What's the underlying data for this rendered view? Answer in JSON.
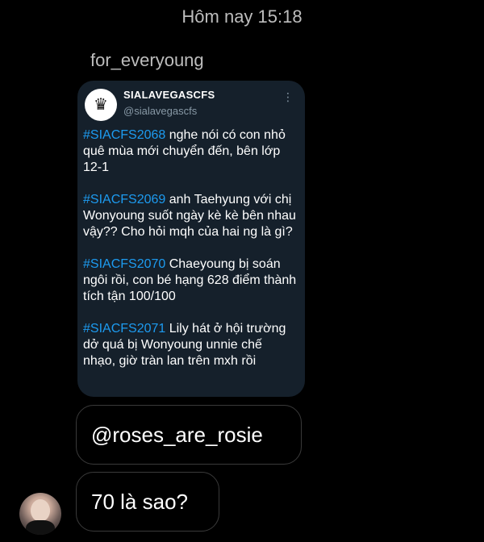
{
  "timestamp": "Hôm nay 15:18",
  "sender": "for_everyoung",
  "tweet": {
    "account_name": "SIALAVEGASCFS",
    "handle": "@sialavegascfs",
    "avatar_icon": "crest-logo-icon",
    "more_icon": "⋮",
    "entries": [
      {
        "tag": "#SIACFS2068",
        "text": " nghe nói có con nhỏ quê mùa mới chuyển đến, bên lớp 12-1"
      },
      {
        "tag": "#SIACFS2069",
        "text": " anh Taehyung với chị Wonyoung suốt ngày kè kè bên nhau vậy?? Cho hỏi mqh của hai ng là gì?"
      },
      {
        "tag": "#SIACFS2070",
        "text": " Chaeyoung bị soán ngôi rồi, con bé hạng 628 điểm thành tích tận 100/100"
      },
      {
        "tag": "#SIACFS2071",
        "text": " Lily hát ở hội trường dở quá bị Wonyoung unnie chế nhạo, giờ tràn lan trên mxh rồi"
      }
    ]
  },
  "messages": [
    {
      "text": "@roses_are_rosie"
    },
    {
      "text": "70 là sao?"
    }
  ],
  "colors": {
    "background": "#000000",
    "card": "#15202b",
    "hashtag": "#1d9bf0",
    "muted": "#8899a6"
  }
}
